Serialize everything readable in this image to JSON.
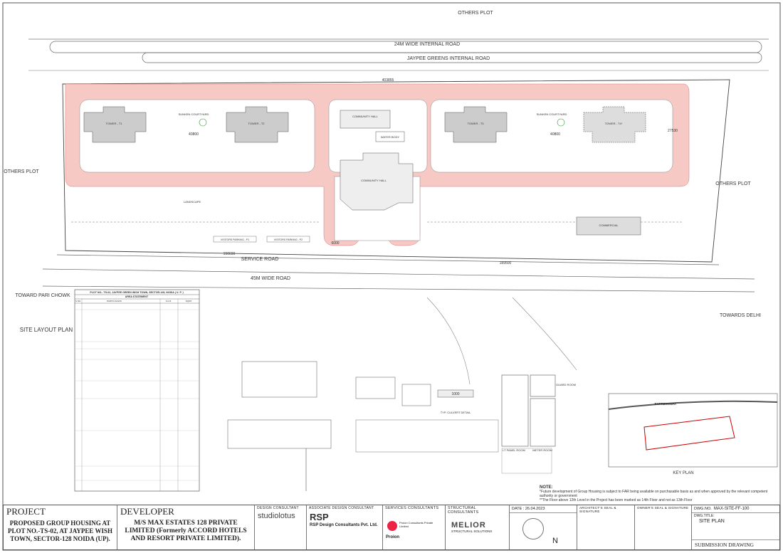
{
  "plan": {
    "others_plot_top": "OTHERS PLOT",
    "road_24m": "24M WIDE INTERNAL ROAD",
    "road_jaypee": "JAYPEE GREENS INTERNAL ROAD",
    "others_plot_left": "OTHERS PLOT",
    "others_plot_right": "OTHERS PLOT",
    "service_road": "SERVICE ROAD",
    "road_45m": "45M WIDE ROAD",
    "toward_pari": "TOWARD PARI CHOWK",
    "towards_delhi": "TOWARDS DELHI",
    "site_layout": "SITE LAYOUT PLAN",
    "key_plan": "KEY PLAN",
    "tower_t1": "TOWER - T1",
    "tower_t2": "TOWER - T2",
    "tower_t3": "TOWER - T3",
    "tower_t4": "TOWER - T4*",
    "community_hall_1": "COMMUNITY HALL",
    "community_hall_2": "COMMUNITY HALL",
    "water_body": "WATER BODY",
    "landscape": "LANDSCAPE",
    "commercial": "COMMERCIAL",
    "sunken_1": "SUNKEN COURTYARD",
    "sunken_2": "SUNKEN COURTYARD",
    "visitors_1": "VISITORS PARKING - P1",
    "visitors_2": "VISITORS PARKING - P2",
    "gaurd_room": "GUARD ROOM",
    "lt_panel": "LT PANEL ROOM",
    "meter_room": "METER ROOM",
    "expressway": "EXPRESSWAY",
    "typ_culvert": "TYP. CULVERT DETAIL",
    "dim_40800a": "40800",
    "dim_40800b": "40800",
    "dim_27530": "27530",
    "dim_190690": "190690",
    "dim_189500": "189500",
    "dim_403855": "403855",
    "dim_6000": "6000",
    "dim_1000": "1000"
  },
  "area_statement": {
    "title": "PLOT NO.- TS-02, JAYPEE GREEN WISH TOWN, SECTOR-128, NOIDA ( U. P. )",
    "subtitle": "AREA STATEMENT",
    "headers": [
      "S.NO.",
      "PARTICULARS",
      "F.A.R.",
      "SQMT"
    ]
  },
  "notes": {
    "head": "NOTE:",
    "line1": "*Future development of Group Housing is subject to FAR being available on purchasable basis as and when approved by the relevant competent authority or government",
    "line2": "**The Floor above 12th Level in the Project has been marked as 14th Floor and not as 13th Floor"
  },
  "title_block": {
    "project_label": "PROJECT",
    "project_name": "PROPOSED GROUP HOUSING AT PLOT NO.-TS-02, AT JAYPEE WISH TOWN, SECTOR-128 NOIDA (UP).",
    "developer_label": "DEVELOPER",
    "developer_name": "M/S MAX ESTATES 128 PRIVATE LIMITED (Formerly ACCORD HOTELS AND RESORT PRIVATE LIMITED).",
    "design_consultant": "DESIGN CONSULTANT",
    "design_logo": "studiolotus",
    "associate_consultant": "ASSOCIATE DESIGN CONSULTANT",
    "rsp_logo": "RSP",
    "rsp_name": "RSP Design Consultants Pvt. Ltd.",
    "services_consultants": "SERVICES CONSULTANTS",
    "proion_name": "Proion Consultants Private Limited",
    "proion_logo": "Proion",
    "structural_consultants": "STRUCTURAL CONSULTANTS",
    "melior_logo": "MELIOR",
    "melior_sub": "STRUCTURAL SOLUTIONS",
    "date_label": "DATE",
    "date_value": "26.04.2023",
    "north": "N",
    "architect_seal": "ARCHITECT'S SEAL & SIGNATURE",
    "owner_seal": "OWNER'S SEAL & SIGNATURE",
    "dwg_no_label": "DWG.NO.",
    "dwg_no": "MAX-SITE-FF-100",
    "dwg_title_label": "DWG.TITLE:",
    "dwg_title": "SITE PLAN",
    "submission": "SUBMISSION DRAWING"
  }
}
